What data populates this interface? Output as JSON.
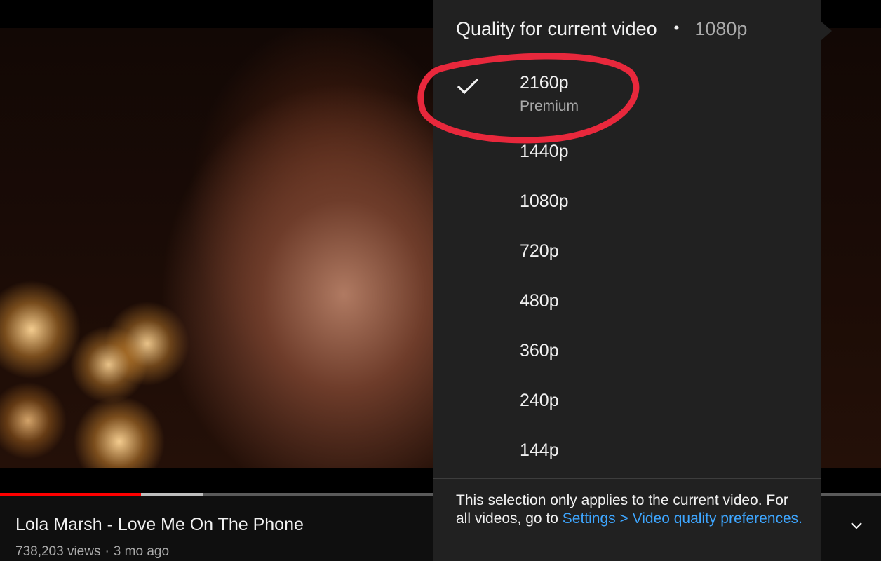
{
  "video": {
    "title": "Lola Marsh - Love Me On The Phone",
    "views": "738,203 views",
    "age": "3 mo ago",
    "separator": "·",
    "progress_played": 0.16,
    "progress_buffered": 0.23
  },
  "quality_menu": {
    "header": "Quality for current video",
    "header_separator": "•",
    "current_quality": "1080p",
    "options": [
      {
        "label": "2160p",
        "sublabel": "Premium",
        "selected": true
      },
      {
        "label": "1440p"
      },
      {
        "label": "1080p"
      },
      {
        "label": "720p"
      },
      {
        "label": "480p"
      },
      {
        "label": "360p"
      },
      {
        "label": "240p"
      },
      {
        "label": "144p"
      }
    ],
    "footer_text": "This selection only applies to the current video. For all videos, go to ",
    "footer_link": "Settings > Video quality preferences."
  },
  "icons": {
    "check": "check-icon",
    "expand": "chevron-down-icon"
  },
  "colors": {
    "accent_red": "#ff0000",
    "link_blue": "#3ea6ff",
    "annotation_red": "#e8283c",
    "menu_bg": "#212121"
  }
}
